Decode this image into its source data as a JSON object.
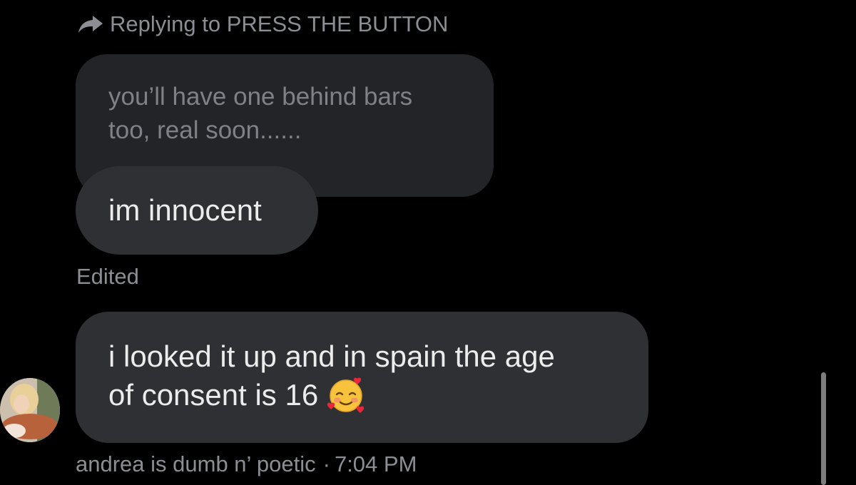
{
  "reply": {
    "label": "Replying to PRESS THE BUTTON",
    "icon": "reply-arrow-icon"
  },
  "quoted_message": {
    "text": "you’ll have one behind bars\ntoo, real soon......"
  },
  "messages": [
    {
      "text": "im innocent",
      "status": "Edited"
    },
    {
      "text": "i looked it up and in spain the age\nof consent is 16",
      "emoji": "smiling-face-with-hearts-icon"
    }
  ],
  "footer": {
    "sender": "andrea is dumb n’ poetic",
    "separator": "·",
    "time": "7:04 PM"
  },
  "colors": {
    "background": "#000000",
    "bubble": "#2f3033",
    "quoted_bubble": "#232427",
    "muted_text": "#8b8e93",
    "message_text": "#ececec"
  }
}
